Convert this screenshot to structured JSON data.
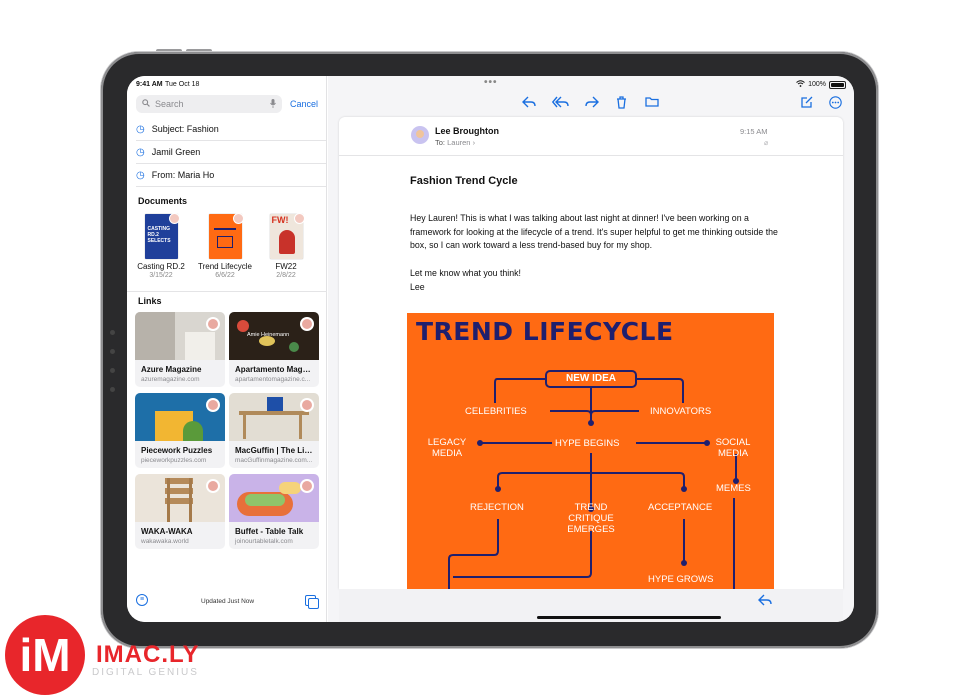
{
  "status_bar": {
    "time": "9:41 AM",
    "date": "Tue Oct 18",
    "battery": "100%",
    "dots": "•••"
  },
  "search": {
    "placeholder": "Search",
    "cancel": "Cancel"
  },
  "recent_searches": [
    "Subject: Fashion",
    "Jamil Green",
    "From: Maria Ho"
  ],
  "documents": {
    "title": "Documents",
    "items": [
      {
        "name": "Casting RD.2",
        "date": "3/15/22",
        "thumb_text": "CASTING RD.2 SELECTS"
      },
      {
        "name": "Trend Lifecycle",
        "date": "6/6/22",
        "thumb_text": ""
      },
      {
        "name": "FW22",
        "date": "2/8/22",
        "thumb_text": "FW!"
      }
    ]
  },
  "links": {
    "title": "Links",
    "items": [
      {
        "title": "Azure Magazine",
        "url": "azuremagazine.com",
        "img_color": "#d9d6d0"
      },
      {
        "title": "Apartamento Maga...",
        "url": "apartamentomagazine.c...",
        "img_color": "#2b2118",
        "img_caption": "Amie Heinemann"
      },
      {
        "title": "Piecework Puzzles",
        "url": "pieceworkpuzzles.com",
        "img_color": "#1e6fa8"
      },
      {
        "title": "MacGuffin | The Lif...",
        "url": "macGuffinmagazine.com...",
        "img_color": "#e2ddd3"
      },
      {
        "title": "WAKA-WAKA",
        "url": "wakawaka.world",
        "img_color": "#d8c3a8"
      },
      {
        "title": "Buffet - Table Talk",
        "url": "joinourtabletalk.com",
        "img_color": "#c9b3e8"
      }
    ]
  },
  "sidebar_footer": {
    "status": "Updated Just Now"
  },
  "message": {
    "sender": "Lee Broughton",
    "to_label": "To:",
    "to_name": "Lauren",
    "time": "9:15 AM",
    "subject": "Fashion Trend Cycle",
    "body": [
      "Hey Lauren! This is what I was talking about last night at dinner! I've been working on a framework for looking at the lifecycle of a trend. It's super helpful to get me thinking outside the box, so I can work toward a less trend-based buy for my shop.",
      "Let me know what you think!",
      "Lee"
    ]
  },
  "infographic": {
    "title": "TREND LIFECYCLE",
    "new_idea": "NEW IDEA",
    "celebrities": "CELEBRITIES",
    "innovators": "INNOVATORS",
    "legacy_media": "LEGACY MEDIA",
    "hype_begins": "HYPE BEGINS",
    "social_media": "SOCIAL MEDIA",
    "memes": "MEMES",
    "rejection": "REJECTION",
    "trend_critique": "TREND CRITIQUE EMERGES",
    "acceptance": "ACCEPTANCE",
    "hype_grows": "HYPE GROWS"
  },
  "colors": {
    "accent": "#1a6fe0",
    "poster_bg": "#ff6a13",
    "poster_ink": "#1f1f6e",
    "brand_red": "#e8262b"
  },
  "watermark": {
    "logo": "iM",
    "name": "IMAC.LY",
    "tagline": "DIGITAL GENIUS"
  }
}
